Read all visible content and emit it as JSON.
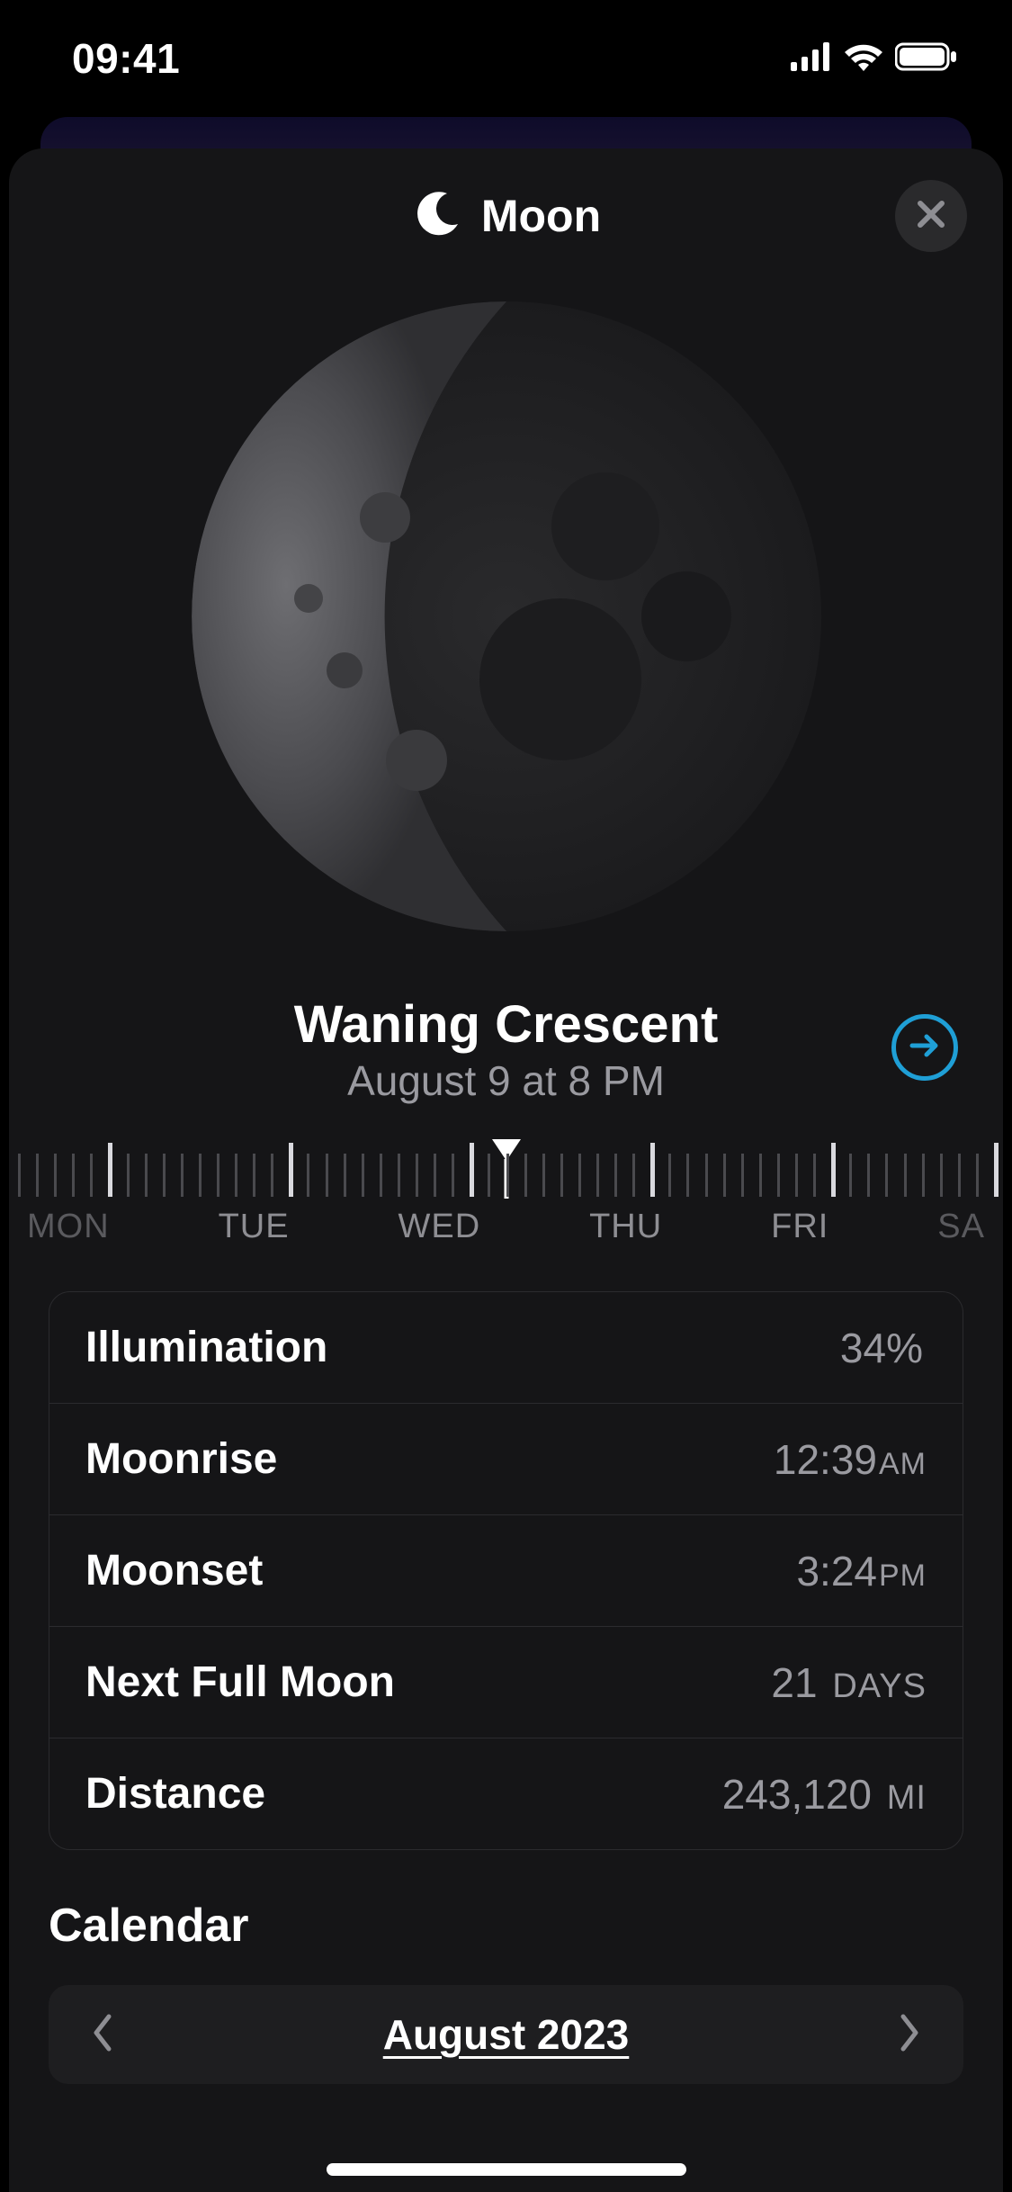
{
  "status": {
    "time": "09:41"
  },
  "header": {
    "title": "Moon"
  },
  "phase": {
    "name": "Waning Crescent",
    "date_label": "August 9 at 8 PM"
  },
  "ruler": {
    "days": [
      "MON",
      "TUE",
      "WED",
      "THU",
      "FRI",
      "SA"
    ]
  },
  "info": {
    "rows": [
      {
        "label": "Illumination",
        "value": "34%",
        "unit": ""
      },
      {
        "label": "Moonrise",
        "value": "12:39",
        "unit": "AM"
      },
      {
        "label": "Moonset",
        "value": "3:24",
        "unit": "PM"
      },
      {
        "label": "Next Full Moon",
        "value": "21",
        "unit": "DAYS"
      },
      {
        "label": "Distance",
        "value": "243,120",
        "unit": "MI"
      }
    ]
  },
  "calendar": {
    "title": "Calendar",
    "month": "August 2023"
  }
}
